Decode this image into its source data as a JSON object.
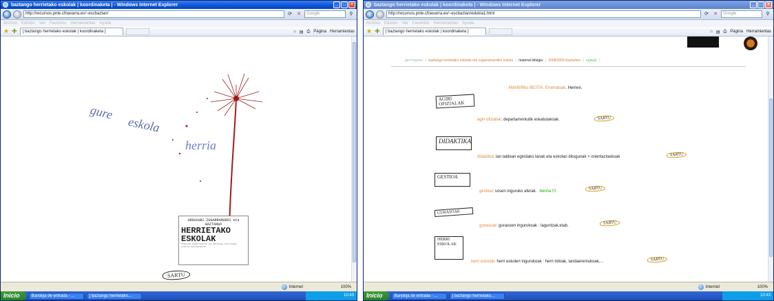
{
  "windows": [
    {
      "title": "baztango herrietako eskolak | koordinaketa | - Windows Internet Explorer",
      "url": "http://recursos.pnte.cfnavarra.es/~escbaztan/",
      "search_placeholder": "Google",
      "menu": [
        "Archivo",
        "Edición",
        "Ver",
        "Favoritos",
        "Herramientas",
        "Ayuda"
      ],
      "tab_label": "[ baztango herrietako eskolak | koordinaketa ]",
      "command_bar": [
        "Página",
        "Herramientas"
      ],
      "status": "Internet",
      "zoom": "100%",
      "page": {
        "title_parts": [
          "gure",
          "eskola",
          "herria"
        ],
        "box_top": "URDAXUBI-ZUGARRAMURDI eta",
        "box_sub": "BAZTANGO",
        "box_main_1": "HERRIETAKO",
        "box_main_2": "ESKOLAK",
        "box_foot": "Urdazubi-Zugarramurdi eta Baztango herrietako eskolen koordinaketa",
        "enter_label": "SARTU"
      }
    },
    {
      "title": "baztango herrietako eskolak | koordinaketa | - Windows Internet Explorer",
      "url": "http://recursos.pnte.cfnavarra.es/~escbaztan/edukia1.html",
      "search_placeholder": "Google",
      "menu": [
        "Archivo",
        "Edición",
        "Ver",
        "Favoritos",
        "Herramientas",
        "Ayuda"
      ],
      "tab_label": "[ baztango herrietako eskolak | koordinaketa ]",
      "command_bar": [
        "Página",
        "Herramientas"
      ],
      "status": "Internet",
      "zoom": "100%",
      "page": {
        "nav": [
          "gerti baztan",
          "baztango herrietako eskolak eta zugarramurdiko eskola",
          "material biltegia",
          "2008/2009 ikasturtea",
          "egileak"
        ],
        "amabi_link": "AMABIRko BESTA. Erretratoak",
        "amabi_rest": ". Hemen.",
        "rows": [
          {
            "sketch": "AGIRI OFIZIALAK",
            "link": "agiri ofizialak",
            "text": " :  departamentutik eskatutakoak.",
            "extra": "",
            "enter": "SARTU"
          },
          {
            "sketch": "DIDAKTIKA",
            "link": "didaktika",
            "text": " :  lan taldean egindako lanak eta eskolan ditugunak + orientazioekoak",
            "extra": "",
            "enter": "SARTU"
          },
          {
            "sketch": "GESTIOA",
            "link": "gestioa",
            "text": " :  sosen inguruko aferak.",
            "extra": "berria !!!",
            "enter": "SARTU"
          },
          {
            "sketch": "GURASOAK",
            "link": "gurasoak",
            "text": " :  gurasoen ingurukoak : laguntzak,etab.",
            "extra": "",
            "enter": "SARTU"
          },
          {
            "sketch": "HERRI ESKOLAK",
            "link": "herri eskolak",
            "text": " :  herri eskolen ingurukoak : herri txikiak, landaeremukoak,...",
            "extra": "",
            "enter": "SARTU"
          }
        ]
      }
    }
  ],
  "taskbar": {
    "start": "Inicio",
    "tasks": [
      "Bandeja de entrada - ...",
      "[ baztango herrietako..."
    ],
    "clock": "10:43"
  },
  "colors": {
    "accent_orange": "#e38a3e",
    "title_blue": "#5b6ea8",
    "new_green": "#4bbd3c",
    "dandelion_red": "#a11a1a"
  }
}
